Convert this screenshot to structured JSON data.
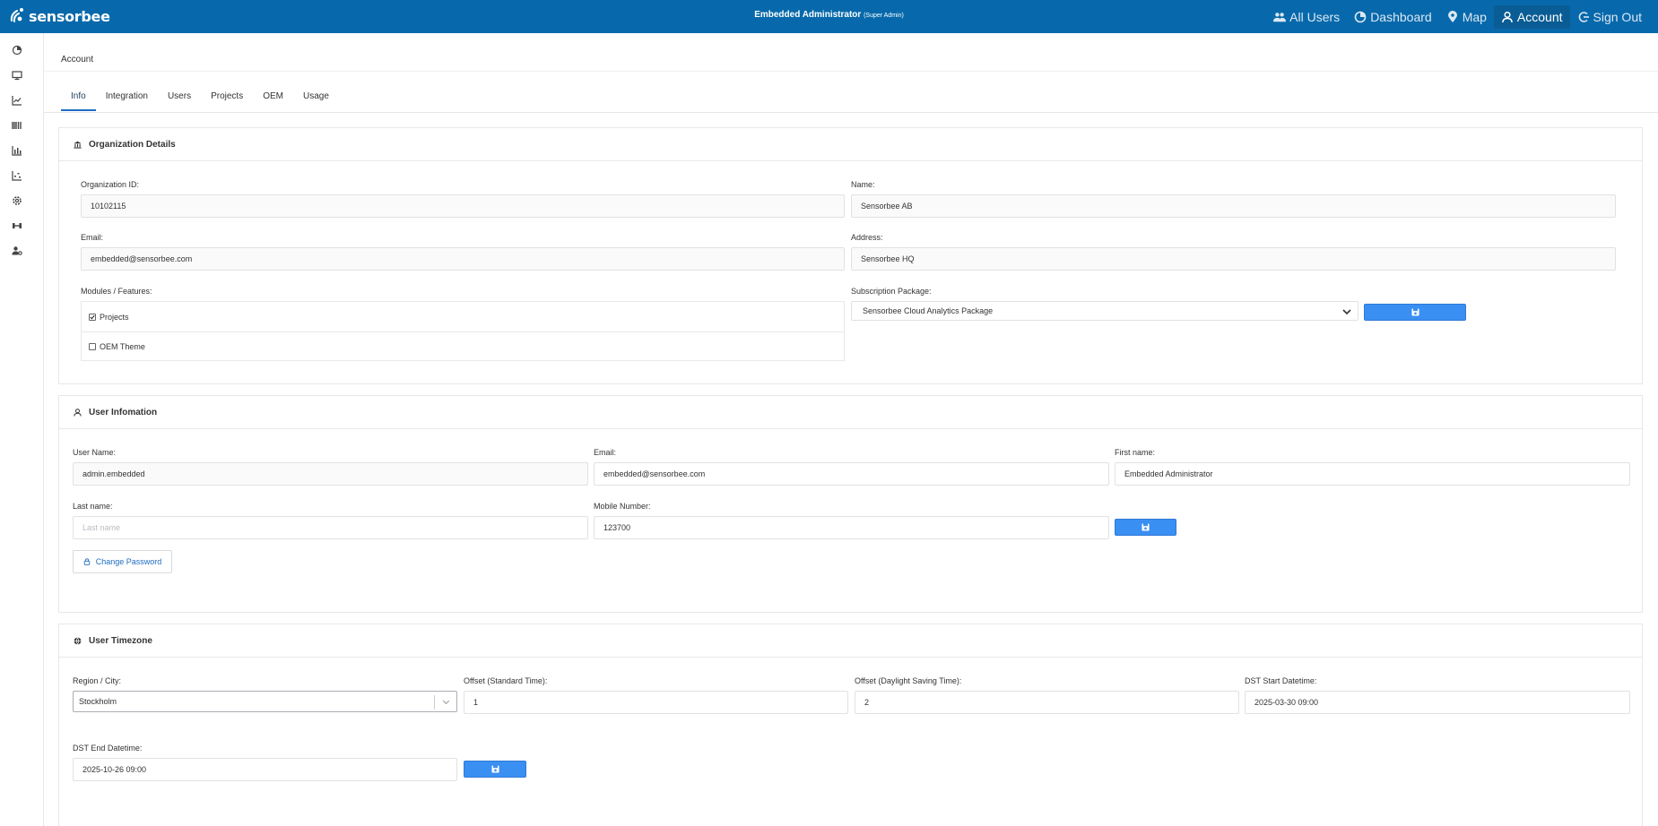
{
  "app": {
    "brand": "sensorbee",
    "user_name": "Embedded Administrator",
    "user_role": "(Super Admin)"
  },
  "nav": {
    "items": [
      {
        "label": "All Users",
        "icon": "users-icon"
      },
      {
        "label": "Dashboard",
        "icon": "dashboard-icon"
      },
      {
        "label": "Map",
        "icon": "map-pin-icon"
      },
      {
        "label": "Account",
        "icon": "user-icon"
      },
      {
        "label": "Sign Out",
        "icon": "signout-icon"
      }
    ],
    "active": "Account"
  },
  "sidebar": {
    "icons": [
      "dashboard-icon",
      "monitor-icon",
      "line-chart-icon",
      "barcode-icon",
      "bar-chart-icon",
      "scatter-icon",
      "gear-icon",
      "tools-icon",
      "user-settings-icon"
    ]
  },
  "page": {
    "title": "Account",
    "tabs": [
      "Info",
      "Integration",
      "Users",
      "Projects",
      "OEM",
      "Usage"
    ],
    "active_tab": "Info"
  },
  "org": {
    "title": "Organization Details",
    "org_id_label": "Organization ID:",
    "org_id": "10102115",
    "name_label": "Name:",
    "name": "Sensorbee AB",
    "email_label": "Email:",
    "email": "embedded@sensorbee.com",
    "address_label": "Address:",
    "address": "Sensorbee HQ",
    "modules_label": "Modules / Features:",
    "modules": [
      {
        "label": "Projects",
        "checked": true
      },
      {
        "label": "OEM Theme",
        "checked": false
      }
    ],
    "subscription_label": "Subscription Package:",
    "subscription": "Sensorbee Cloud Analytics Package"
  },
  "user": {
    "title": "User Infomation",
    "username_label": "User Name:",
    "username": "admin.embedded",
    "email_label": "Email:",
    "email": "embedded@sensorbee.com",
    "first_name_label": "First name:",
    "first_name": "Embedded Administrator",
    "last_name_label": "Last name:",
    "last_name": "",
    "last_name_placeholder": "Last name",
    "mobile_label": "Mobile Number:",
    "mobile": "123700",
    "change_password": "Change Password"
  },
  "timezone": {
    "title": "User Timezone",
    "region_label": "Region / City:",
    "region": "Stockholm",
    "offset_std_label": "Offset (Standard Time):",
    "offset_std": "1",
    "offset_dst_label": "Offset (Daylight Saving Time):",
    "offset_dst": "2",
    "dst_start_label": "DST Start Datetime:",
    "dst_start": "2025-03-30 09:00",
    "dst_end_label": "DST End Datetime:",
    "dst_end": "2025-10-26 09:00"
  },
  "colors": {
    "header": "#0769ab",
    "primary_button": "#3a8ff2",
    "link": "#1e6dc1"
  }
}
